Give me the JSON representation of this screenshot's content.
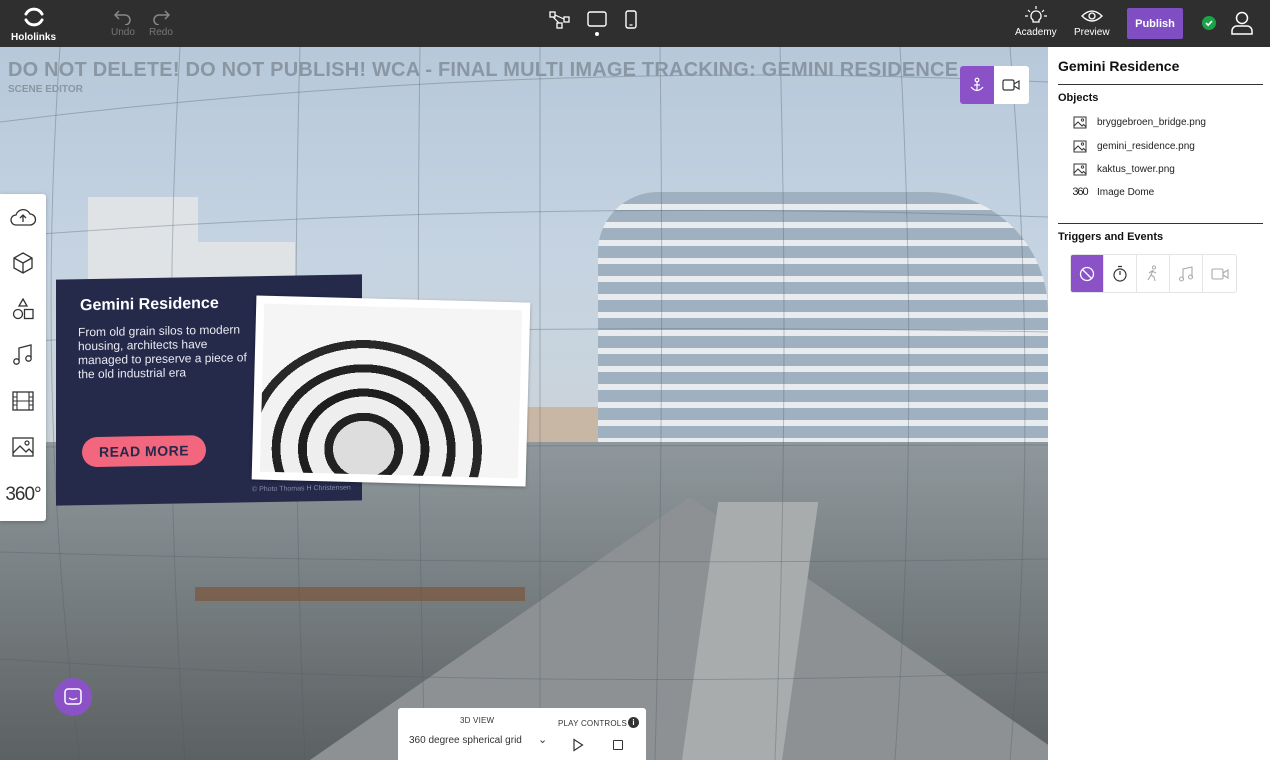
{
  "app": {
    "name": "Hololinks"
  },
  "topbar": {
    "undo_label": "Undo",
    "redo_label": "Redo",
    "academy_label": "Academy",
    "preview_label": "Preview",
    "publish_label": "Publish",
    "device_modes": [
      "network-icon",
      "tablet-icon",
      "phone-icon"
    ],
    "active_device": "tablet"
  },
  "scene": {
    "title": "DO NOT DELETE! DO NOT PUBLISH! WCA - FINAL MULTI IMAGE TRACKING: GEMINI RESIDENCE",
    "subtitle": "SCENE EDITOR",
    "active_view": "anchor"
  },
  "card": {
    "title": "Gemini Residence",
    "text": "From old grain silos to modern housing, architects have managed to preserve a piece of the old industrial era",
    "button_label": "READ MORE",
    "credit": "© Photo Thomas H Christensen"
  },
  "toolbar": {
    "tools": [
      "cloud-upload-icon",
      "cube-icon",
      "shapes-icon",
      "music-icon",
      "film-icon",
      "image-icon",
      "360-icon"
    ],
    "label_360": "360°"
  },
  "bottom": {
    "view_label": "3D VIEW",
    "view_select": "360 degree spherical grid",
    "play_label": "PLAY CONTROLS",
    "info_glyph": "i"
  },
  "panel": {
    "title": "Gemini Residence",
    "objects_heading": "Objects",
    "objects": [
      {
        "name": "bryggebroen_bridge.png",
        "icon": "image-icon"
      },
      {
        "name": "gemini_residence.png",
        "icon": "image-icon"
      },
      {
        "name": "kaktus_tower.png",
        "icon": "image-icon"
      },
      {
        "name": "Image Dome",
        "icon": "360-icon"
      }
    ],
    "icon_360_text": "360",
    "triggers_heading": "Triggers and Events",
    "triggers": [
      "none-icon",
      "timer-icon",
      "walk-icon",
      "music-icon",
      "video-icon"
    ]
  },
  "colors": {
    "accent": "#8a52c6",
    "topbar": "#2f2f2f",
    "card": "#25294a",
    "card_button": "#f2677e",
    "status": "#1ca34a"
  }
}
